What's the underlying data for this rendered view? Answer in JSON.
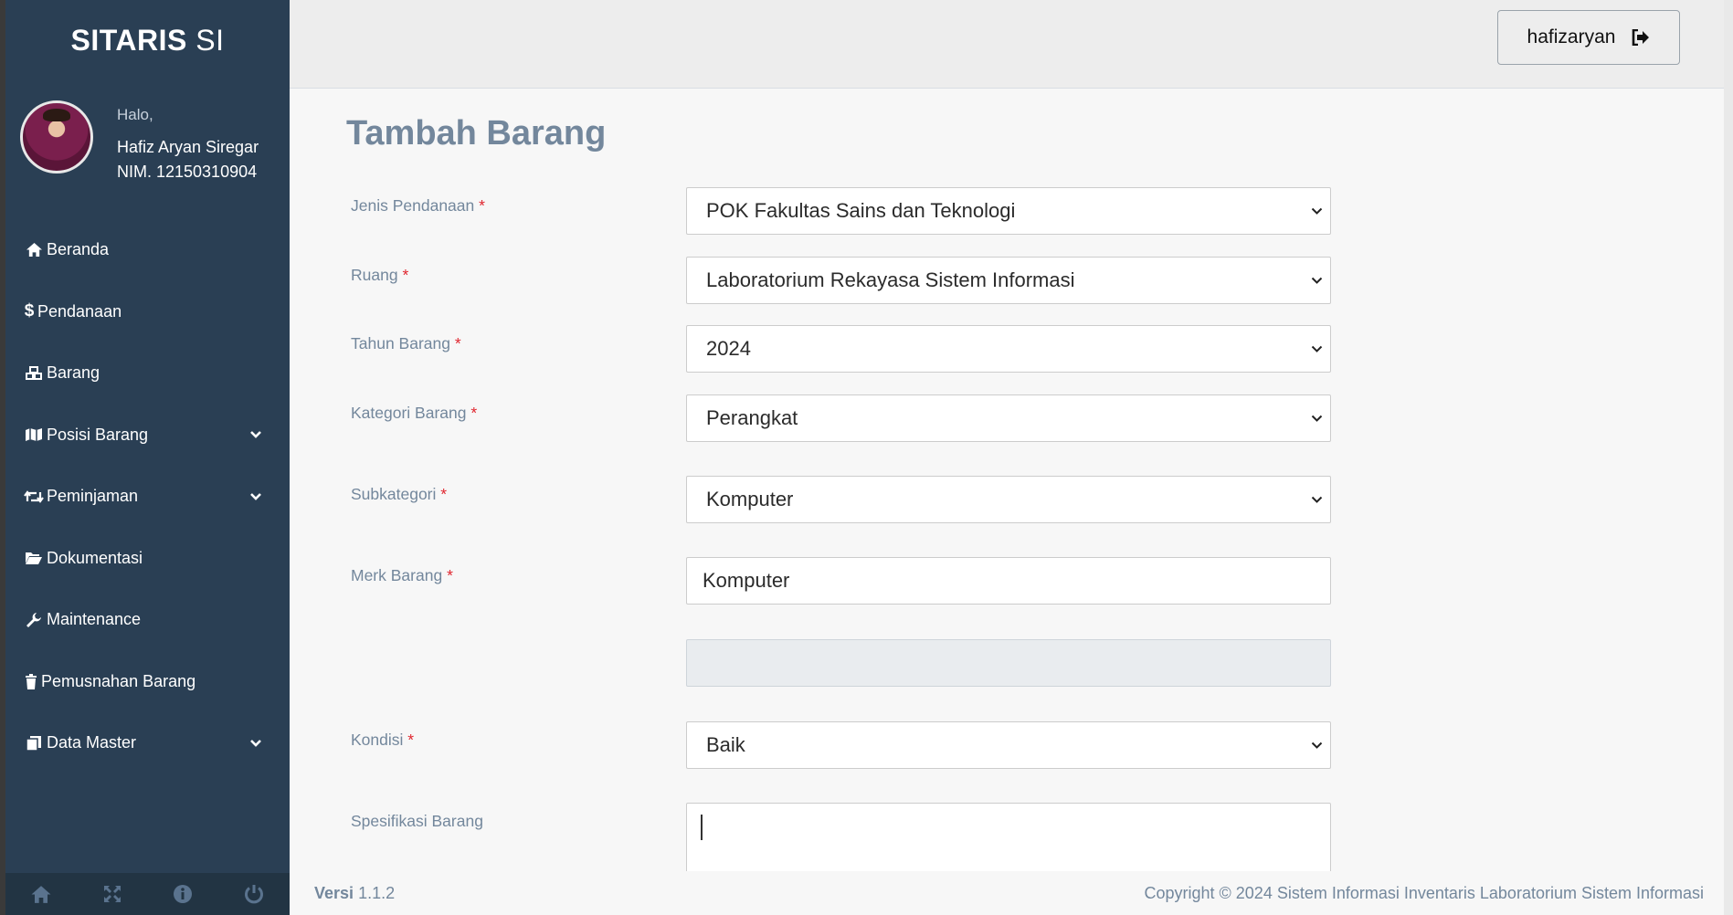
{
  "brand": {
    "bold": "SITARIS",
    "suffix": " SI"
  },
  "profile": {
    "greeting": "Halo,",
    "name": "Hafiz Aryan Siregar",
    "nim": "NIM. 12150310904"
  },
  "sidebar": {
    "items": [
      {
        "label": "Beranda",
        "icon": "home-icon"
      },
      {
        "label": "Pendanaan",
        "icon": "dollar-icon"
      },
      {
        "label": "Barang",
        "icon": "cubes-icon"
      },
      {
        "label": "Posisi Barang",
        "icon": "map-icon",
        "expandable": true
      },
      {
        "label": "Peminjaman",
        "icon": "retweet-icon",
        "expandable": true
      },
      {
        "label": "Dokumentasi",
        "icon": "folder-open-icon"
      },
      {
        "label": "Maintenance",
        "icon": "wrench-icon"
      },
      {
        "label": "Pemusnahan Barang",
        "icon": "trash-icon"
      },
      {
        "label": "Data Master",
        "icon": "copy-icon",
        "expandable": true
      }
    ],
    "footer_icons": [
      "home-icon",
      "expand-icon",
      "info-icon",
      "power-icon"
    ]
  },
  "topbar": {
    "username": "hafizaryan",
    "logout_icon": "sign-out-icon"
  },
  "page": {
    "title": "Tambah Barang"
  },
  "form": {
    "jenis_pendanaan": {
      "label": "Jenis Pendanaan",
      "required": "*",
      "value": "POK Fakultas Sains dan Teknologi"
    },
    "ruang": {
      "label": "Ruang",
      "required": "*",
      "value": "Laboratorium Rekayasa Sistem Informasi"
    },
    "tahun_barang": {
      "label": "Tahun Barang",
      "required": "*",
      "value": "2024"
    },
    "kategori_barang": {
      "label": "Kategori Barang",
      "required": "*",
      "value": "Perangkat"
    },
    "subkategori": {
      "label": "Subkategori",
      "required": "*",
      "value": "Komputer"
    },
    "merk_barang": {
      "label": "Merk Barang",
      "required": "*",
      "value": "Komputer"
    },
    "disabled_field": {
      "value": ""
    },
    "kondisi": {
      "label": "Kondisi",
      "required": "*",
      "value": "Baik"
    },
    "spesifikasi_barang": {
      "label": "Spesifikasi Barang",
      "value": ""
    }
  },
  "footer": {
    "version_label": "Versi",
    "version": "1.1.2",
    "copyright": "Copyright © 2024 Sistem Informasi Inventaris Laboratorium Sistem Informasi"
  },
  "colors": {
    "sidebar_bg": "#2a3f54",
    "title": "#73879c",
    "required": "#e0262f"
  }
}
